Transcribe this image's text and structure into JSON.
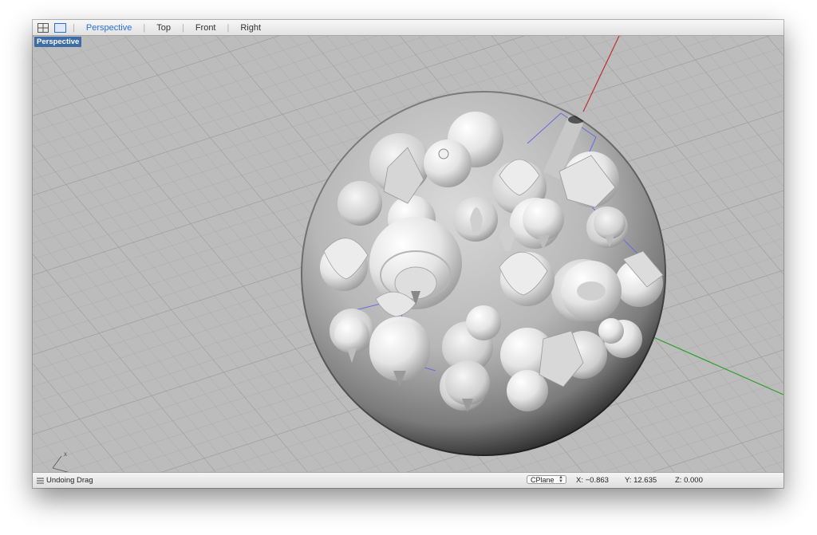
{
  "toolbar": {
    "tabs": [
      {
        "label": "Perspective",
        "active": true
      },
      {
        "label": "Top",
        "active": false
      },
      {
        "label": "Front",
        "active": false
      },
      {
        "label": "Right",
        "active": false
      }
    ]
  },
  "viewport": {
    "label": "Perspective",
    "axis_x": "x",
    "axis_y": "y",
    "axis_colors": {
      "x": "#c03030",
      "y": "#28a028"
    }
  },
  "status": {
    "message": "Undoing Drag",
    "cplane": "CPlane",
    "x": "X: −0.863",
    "y": "Y: 12.635",
    "z": "Z: 0.000"
  }
}
